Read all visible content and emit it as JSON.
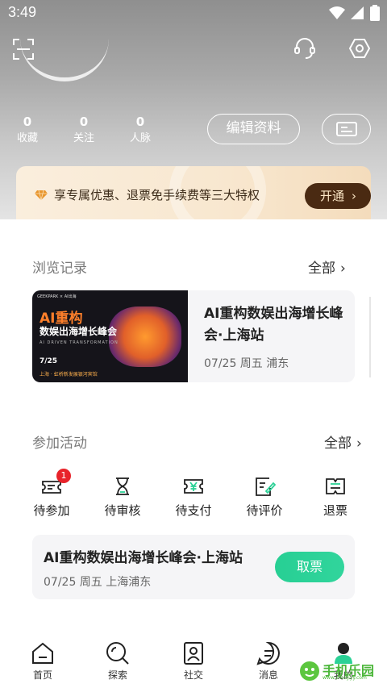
{
  "status_bar": {
    "time": "3:49",
    "icons": [
      "wifi-icon",
      "signal-icon",
      "battery-icon"
    ]
  },
  "top_bar": {
    "icons": [
      "scan-icon",
      "customer-service-icon",
      "settings-icon"
    ]
  },
  "profile": {
    "stats": [
      {
        "value": "0",
        "label": "收藏"
      },
      {
        "value": "0",
        "label": "关注"
      },
      {
        "value": "0",
        "label": "人脉"
      }
    ],
    "edit_label": "编辑资料",
    "card_icon": "id-card-icon"
  },
  "vip_banner": {
    "icon": "diamond-icon",
    "text": "享专属优惠、退票免手续费等三大特权",
    "button_label": "开通",
    "accent": "#4a2a12"
  },
  "browse_history": {
    "title": "浏览记录",
    "see_all": "全部",
    "items": [
      {
        "poster": {
          "line1": "AI重构",
          "line2": "数娱出海增长峰会",
          "line3": "AI DRIVEN TRANSFORMATION",
          "date": "7/25",
          "location": "上海 · 虹桥新发展银河宾馆",
          "logos": "GEEKPARK  ×  AI出海"
        },
        "title": "AI重构数娱出海增长峰会·上海站",
        "meta": "07/25 周五  浦东"
      }
    ]
  },
  "activities": {
    "title": "参加活动",
    "see_all": "全部",
    "statuses": [
      {
        "label": "待参加",
        "icon": "ticket-icon",
        "badge": "1"
      },
      {
        "label": "待审核",
        "icon": "hourglass-icon"
      },
      {
        "label": "待支付",
        "icon": "yen-ticket-icon"
      },
      {
        "label": "待评价",
        "icon": "review-icon"
      },
      {
        "label": "退票",
        "icon": "refund-icon"
      }
    ],
    "ticket": {
      "title": "AI重构数娱出海增长峰会·上海站",
      "meta": "07/25 周五  上海浦东",
      "button_label": "取票",
      "accent": "#2bd196"
    }
  },
  "bottom_nav": {
    "items": [
      {
        "label": "首页",
        "icon": "home-icon"
      },
      {
        "label": "探索",
        "icon": "explore-icon"
      },
      {
        "label": "社交",
        "icon": "social-icon"
      },
      {
        "label": "消息",
        "icon": "message-icon"
      },
      {
        "label": "我的",
        "icon": "profile-icon",
        "active": true
      }
    ]
  },
  "watermark": {
    "text": "手机乐园",
    "sub": "www.shoujiyy.com"
  }
}
